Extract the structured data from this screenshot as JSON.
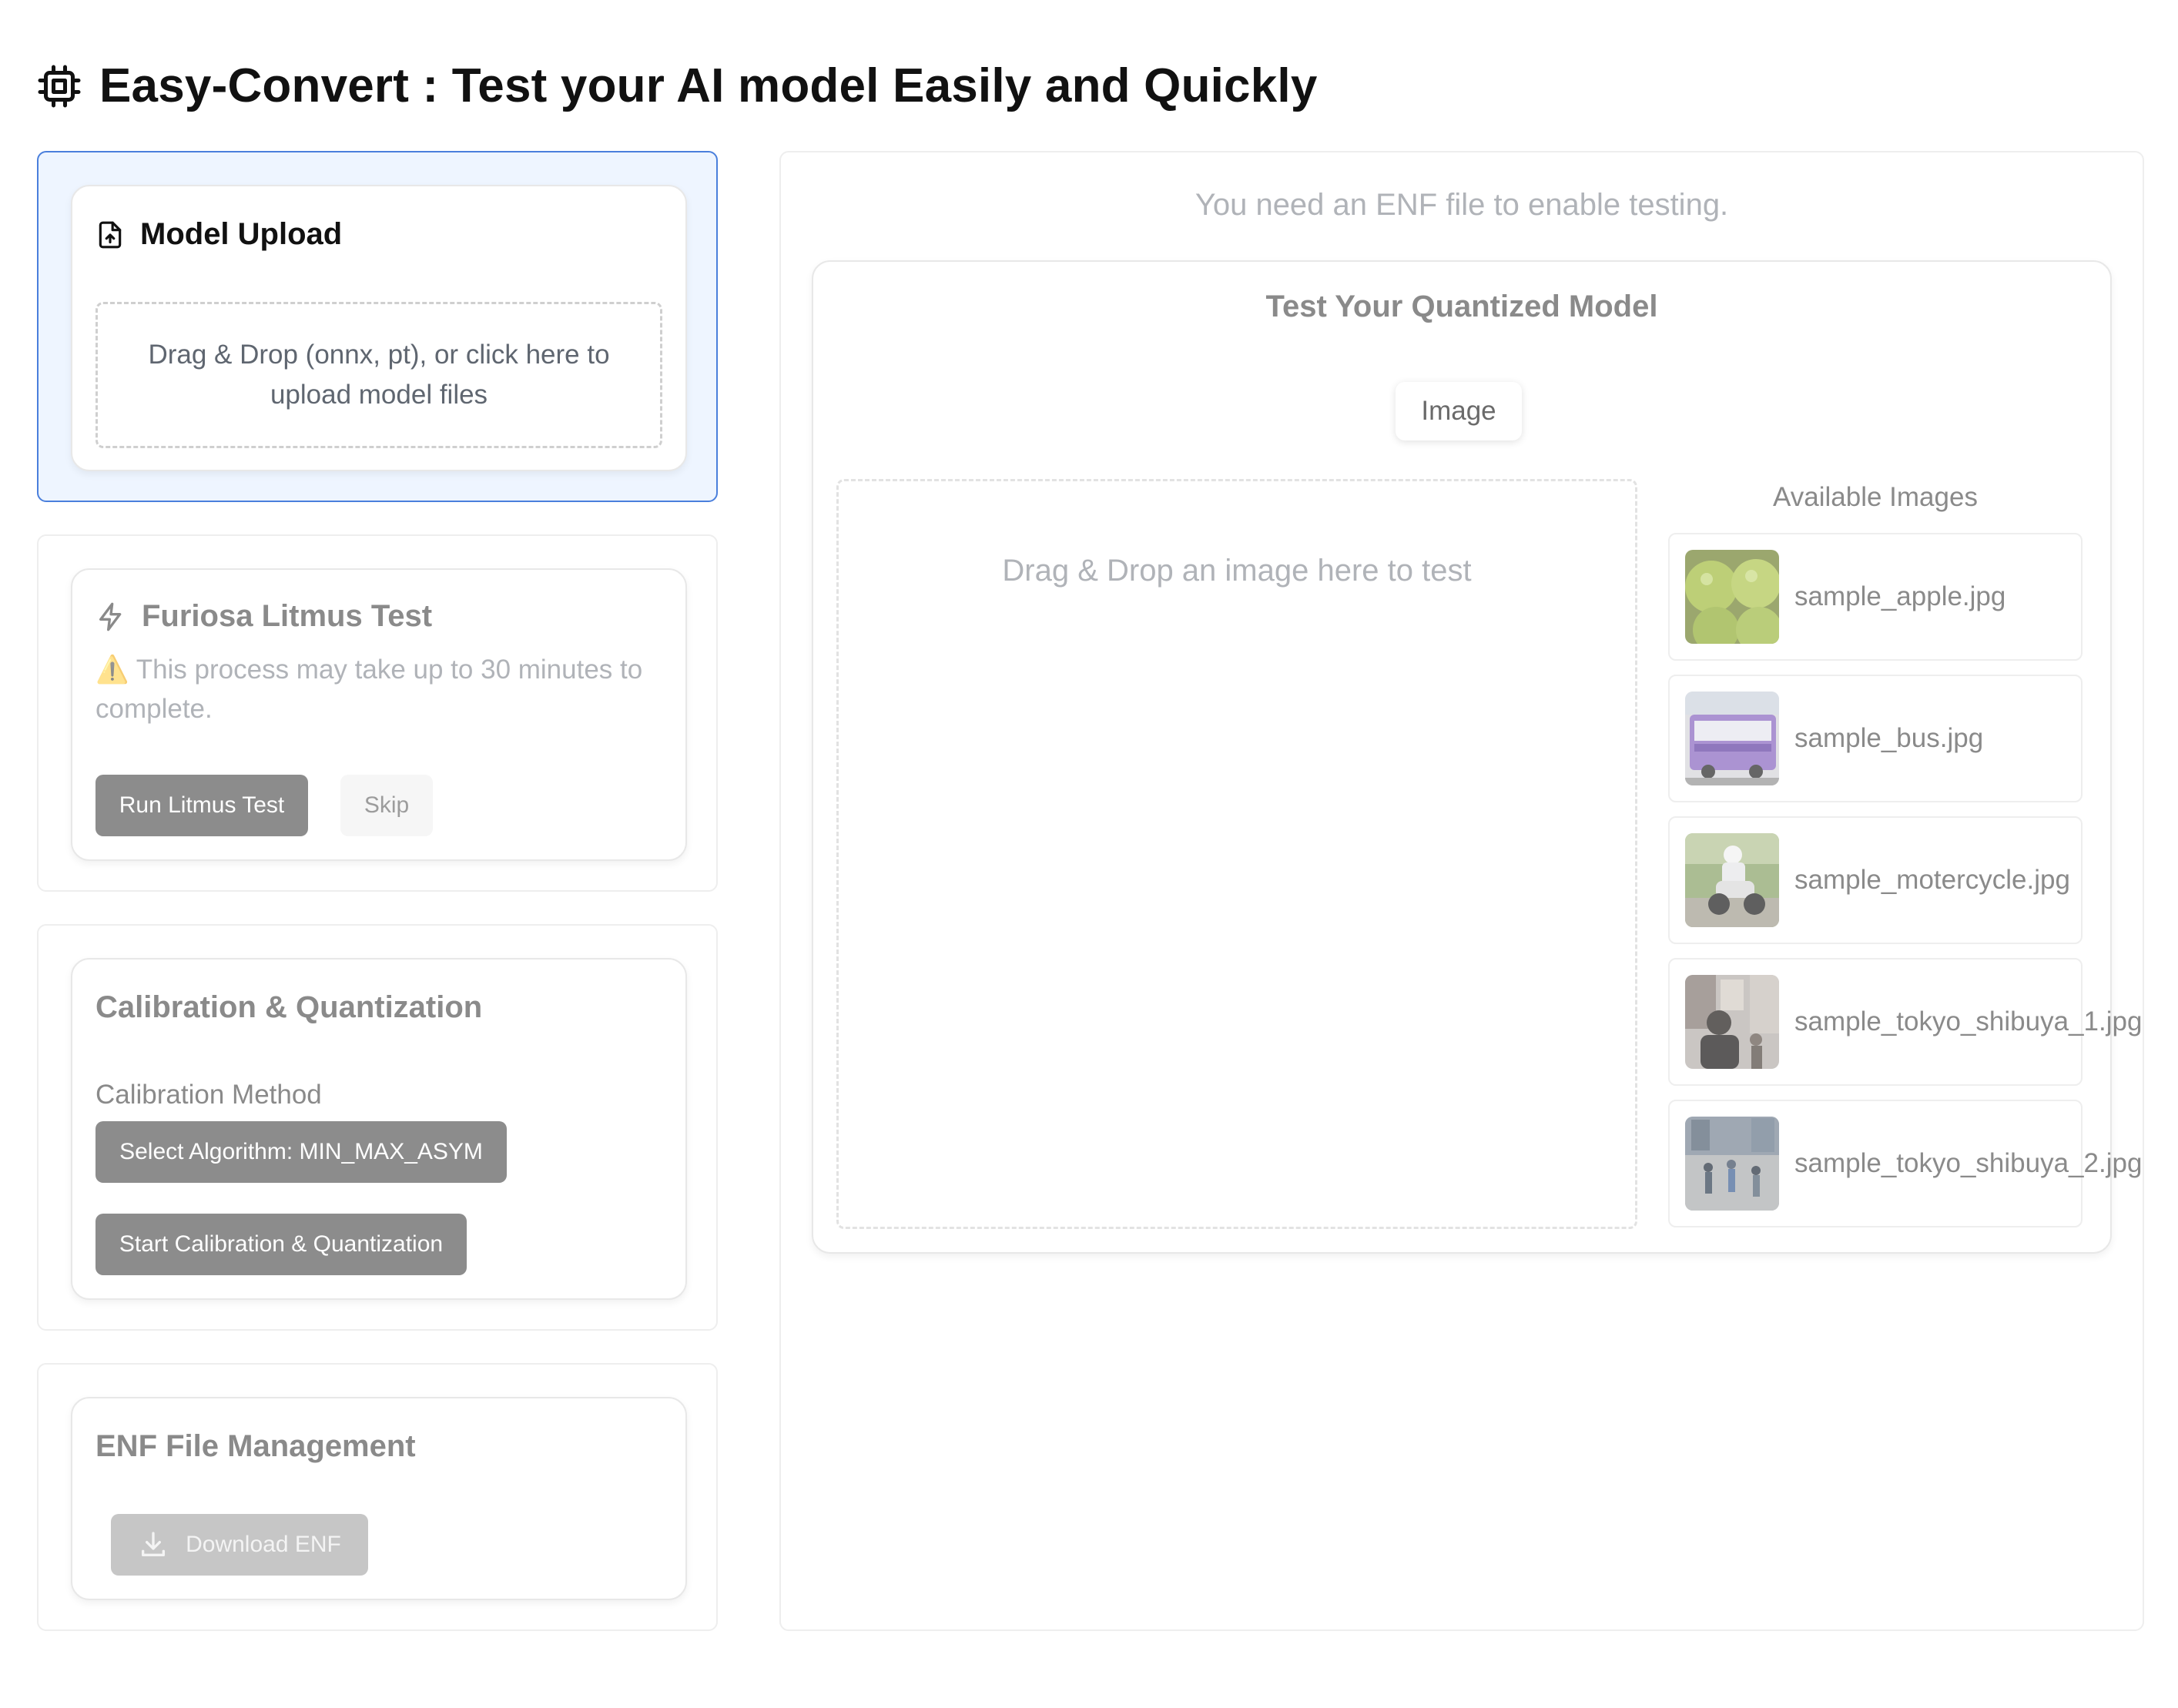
{
  "header": {
    "title": "Easy-Convert : Test your AI model Easily and Quickly",
    "icon": "cpu-icon"
  },
  "model_upload": {
    "title": "Model Upload",
    "icon": "file-upload-icon",
    "dropzone_text": "Drag & Drop (onnx, pt), or click here to upload model files"
  },
  "litmus": {
    "title": "Furiosa Litmus Test",
    "icon": "lightning-icon",
    "warning_icon": "⚠️",
    "warning": "This process may take up to 30 minutes to complete.",
    "run_button": "Run Litmus Test",
    "skip_button": "Skip"
  },
  "calibration": {
    "title": "Calibration & Quantization",
    "method_label": "Calibration Method",
    "algorithm_button": "Select Algorithm: MIN_MAX_ASYM",
    "start_button": "Start Calibration & Quantization"
  },
  "enf": {
    "title": "ENF File Management",
    "download_button": "Download ENF",
    "download_icon": "download-icon"
  },
  "test": {
    "notice": "You need an ENF file to enable testing.",
    "title": "Test Your Quantized Model",
    "tab_image": "Image",
    "dropzone_text": "Drag & Drop an image here to test",
    "available_title": "Available Images",
    "images": [
      {
        "name": "sample_apple.jpg"
      },
      {
        "name": "sample_bus.jpg"
      },
      {
        "name": "sample_motercycle.jpg"
      },
      {
        "name": "sample_tokyo_shibuya_1.jpg"
      },
      {
        "name": "sample_tokyo_shibuya_2.jpg"
      }
    ]
  },
  "colors": {
    "accent_border": "#4a7fdc",
    "active_bg": "#eef5ff",
    "button_gray": "#8c8c8c"
  }
}
